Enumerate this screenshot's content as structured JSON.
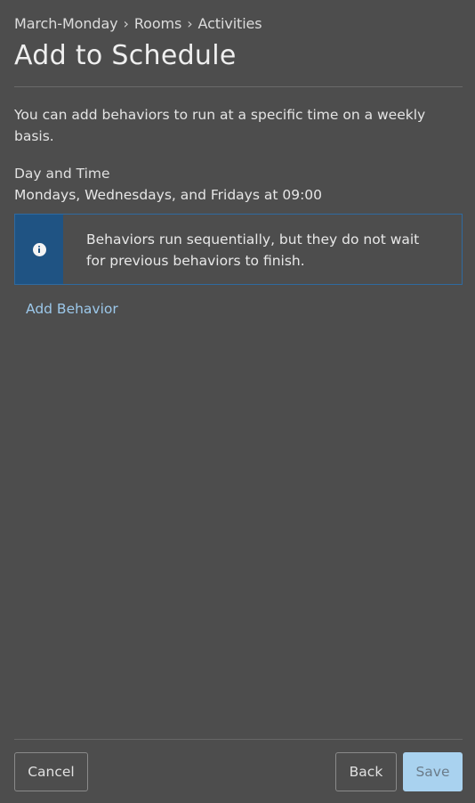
{
  "breadcrumb": {
    "items": [
      "March-Monday",
      "Rooms",
      "Activities"
    ],
    "separator": "›"
  },
  "page": {
    "title": "Add to Schedule",
    "intro": "You can add behaviors to run at a specific time on a weekly basis."
  },
  "schedule": {
    "label": "Day and Time",
    "value": "Mondays, Wednesdays, and Fridays at 09:00"
  },
  "info": {
    "icon": "info-icon",
    "text": "Behaviors run sequentially, but they do not wait for previous behaviors to finish."
  },
  "actions": {
    "add_behavior": "Add Behavior"
  },
  "footer": {
    "cancel": "Cancel",
    "back": "Back",
    "save": "Save"
  },
  "colors": {
    "background": "#4d4d4d",
    "info_accent": "#1f5383",
    "link": "#9cc8ea",
    "save_button": "#a9d2ef"
  }
}
